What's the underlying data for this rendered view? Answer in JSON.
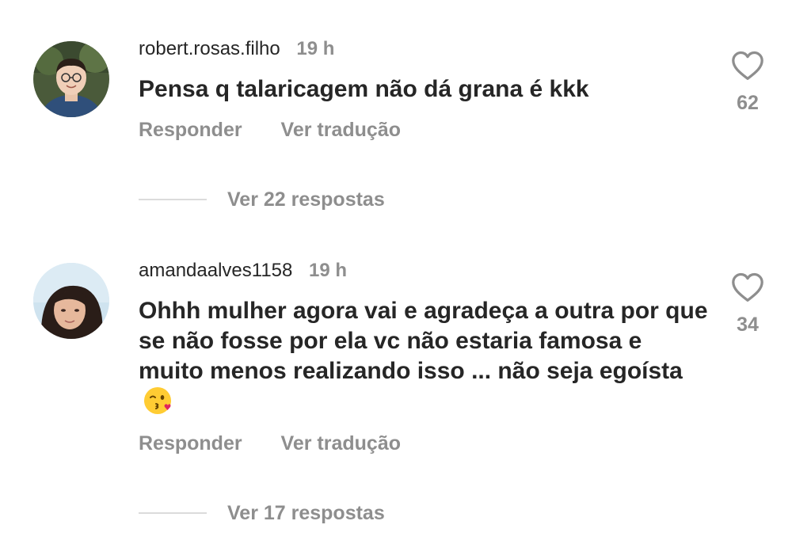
{
  "comments": [
    {
      "username": "robert.rosas.filho",
      "time": "19 h",
      "text": "Pensa q talaricagem não dá grana é kkk",
      "reply_label": "Responder",
      "translate_label": "Ver tradução",
      "view_replies_label": "Ver 22 respostas",
      "likes": "62",
      "avatar_icon": "avatar-male-glasses"
    },
    {
      "username": "amandaalves1158",
      "time": "19 h",
      "text": "Ohhh mulher  agora vai e agradeça a outra por que se não fosse por ela vc não estaria famosa e muito menos realizando isso ... não seja egoísta",
      "emoji": "kissing-wink-emoji",
      "reply_label": "Responder",
      "translate_label": "Ver tradução",
      "view_replies_label": "Ver 17 respostas",
      "likes": "34",
      "avatar_icon": "avatar-female"
    }
  ],
  "colors": {
    "text_primary": "#262626",
    "text_secondary": "#8e8e8e",
    "divider": "#dbdbdb",
    "background": "#ffffff"
  },
  "icons": {
    "like": "heart-outline-icon"
  }
}
